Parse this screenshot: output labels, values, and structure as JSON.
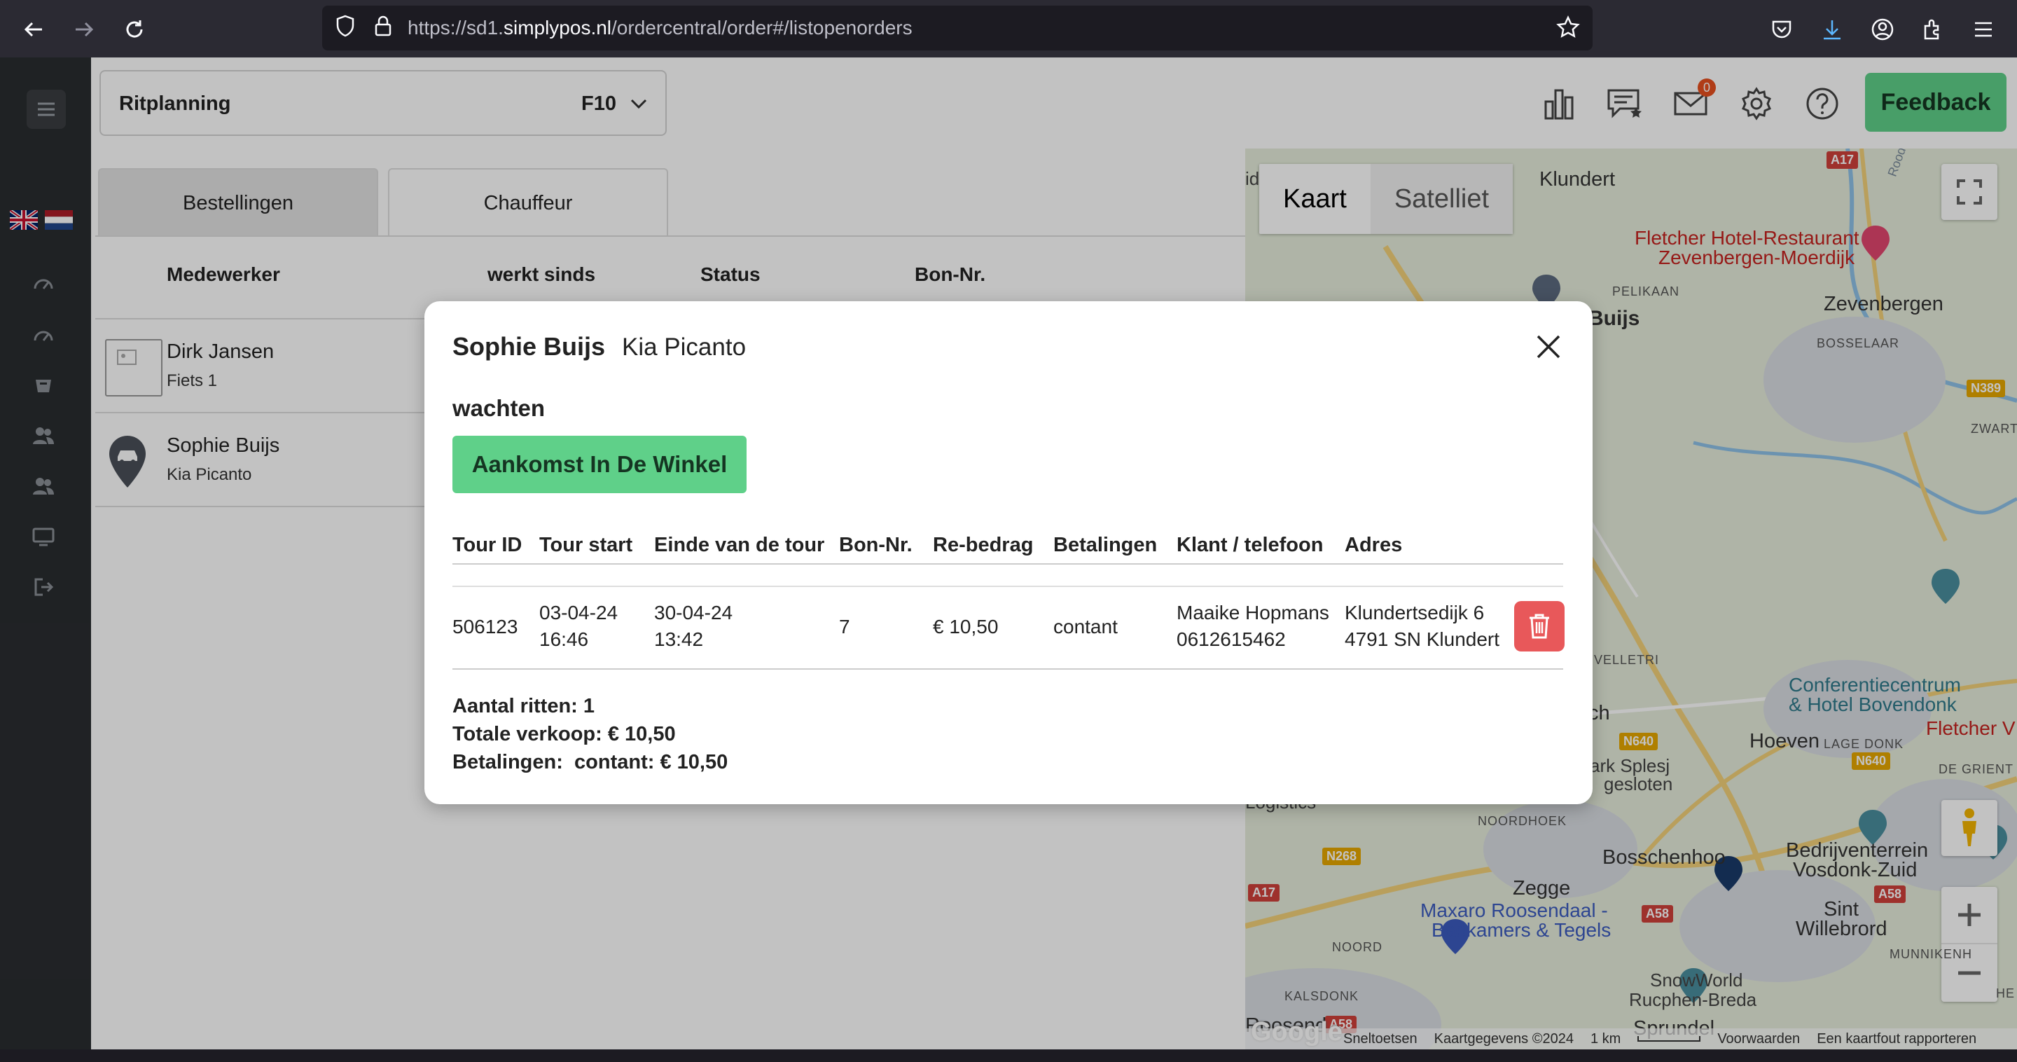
{
  "browser": {
    "url_prefix": "https://sd1.",
    "url_host": "simplypos.nl",
    "url_path": "/ordercentral/order#/listopenorders"
  },
  "header": {
    "select_label": "Ritplanning",
    "select_value": "F10",
    "mail_count": "0",
    "feedback_label": "Feedback"
  },
  "tabs": [
    {
      "label": "Bestellingen",
      "active": true
    },
    {
      "label": "Chauffeur",
      "active": false
    }
  ],
  "table": {
    "headers": [
      "Medewerker",
      "werkt sinds",
      "Status",
      "Bon-Nr."
    ],
    "rows": [
      {
        "name": "Dirk Jansen",
        "vehicle": "Fiets 1"
      },
      {
        "name": "Sophie Buijs",
        "vehicle": "Kia Picanto"
      }
    ]
  },
  "map": {
    "tabs": [
      "Kaart",
      "Satelliet"
    ],
    "labels": {
      "klundert": "Klundert",
      "fletcher": "Fletcher Hotel-Restaurant",
      "fletcher2": "Zevenbergen-Moerdijk",
      "zevenbergen": "Zevenbergen",
      "pelikaan": "PELIKAAN",
      "bosselaar": "BOSSELAAR",
      "zwartenb": "ZWARTENBI",
      "buijs": "Buijs",
      "velletri": "VELLETRI",
      "conf1": "Conferentiecentrum",
      "conf2": "& Hotel Bovendonk",
      "fletcherv": "Fletcher V",
      "hoeven": "Hoeven",
      "lagedonk": "LAGE DONK",
      "degrient": "DE GRIENT",
      "ch": "ch",
      "splesj1": "ark Splesj",
      "splesj2": "gesloten",
      "logistics": "Logistics",
      "noordhoek": "NOORDHOEK",
      "bosschenhoo": "Bosschenhoo",
      "zegge": "Zegge",
      "bedrijven1": "Bedrijventerrein",
      "bedrijven2": "Vosdonk-Zuid",
      "maxaro1": "Maxaro Roosendaal -",
      "maxaro2": "Badkamers & Tegels",
      "noord": "NOORD",
      "sint1": "Sint",
      "sint2": "Willebrord",
      "munnikenh": "MUNNIKENH",
      "kalsdonk": "KALSDONK",
      "snowworld1": "SnowWorld",
      "snowworld2": "Rucphen-Breda",
      "roosendaal": "Roosendaal",
      "sprundel": "Sprundel",
      "he": "HE",
      "id": "id",
      "a17": "A17",
      "a17b": "A17",
      "n389": "N389",
      "n640": "N640",
      "n640b": "N640",
      "n268": "N268",
      "a58": "A58",
      "a58b": "A58",
      "a58c": "A58",
      "roode": "Roode"
    },
    "footer": [
      "Sneltoetsen",
      "Kaartgegevens ©2024",
      "1 km",
      "Voorwaarden",
      "Een kaartfout rapporteren"
    ],
    "google": "Google"
  },
  "modal": {
    "name": "Sophie Buijs",
    "vehicle": "Kia Picanto",
    "status": "wachten",
    "action_label": "Aankomst In De Winkel",
    "headers": [
      "Tour ID",
      "Tour start",
      "Einde van de tour",
      "Bon-Nr.",
      "Re-bedrag",
      "Betalingen",
      "Klant / telefoon",
      "Adres"
    ],
    "row": {
      "tour_id": "506123",
      "start_date": "03-04-24",
      "start_time": "16:46",
      "end_date": "30-04-24",
      "end_time": "13:42",
      "bon_nr": "7",
      "amount": "€ 10,50",
      "payment": "contant",
      "customer": "Maaike Hopmans",
      "phone": "0612615462",
      "street": "Klundertsedijk 6",
      "city": "4791 SN Klundert"
    },
    "summary": {
      "rides": "Aantal ritten: 1",
      "total": "Totale verkoop: € 10,50",
      "payments": "Betalingen:  contant: € 10,50"
    }
  },
  "colors": {
    "accent_green": "#5fd089",
    "delete_red": "#e8585a",
    "sidebar": "#2a2d30"
  }
}
